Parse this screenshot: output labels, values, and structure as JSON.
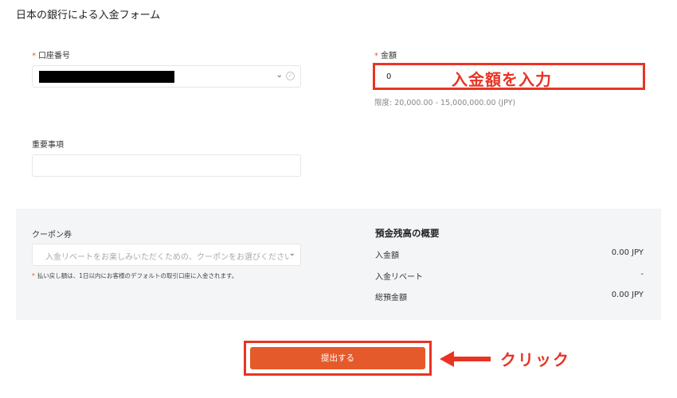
{
  "page": {
    "title": "日本の銀行による入金フォーム"
  },
  "form": {
    "account": {
      "required_mark": "*",
      "label": "口座番号",
      "chevron_icon": "chevron-down-icon",
      "check_icon": "check-circle-icon"
    },
    "amount": {
      "required_mark": "*",
      "label": "金額",
      "value": "0",
      "limit": "限度: 20,000.00 - 15,000,000.00 (JPY)"
    },
    "memo": {
      "label": "重要事項",
      "value": ""
    }
  },
  "coupon": {
    "label": "クーポン券",
    "placeholder": "入金リベートをお楽しみいただくための、クーポンをお選びください",
    "note_mark": "*",
    "note": "払い戻し額は、1日以内にお客様のデフォルトの取引口座に入金されます。"
  },
  "summary": {
    "title": "預金残高の概要",
    "rows": [
      {
        "label": "入金額",
        "value": "0.00 JPY"
      },
      {
        "label": "入金リベート",
        "value": "-"
      },
      {
        "label": "総預金額",
        "value": "0.00 JPY"
      }
    ]
  },
  "submit": {
    "label": "提出する"
  },
  "annotations": {
    "amount_hint": "入金額を入力",
    "click_hint": "クリック",
    "color": "#ea3323"
  },
  "colors": {
    "accent": "#e55a2b",
    "panel": "#f4f5f7"
  }
}
